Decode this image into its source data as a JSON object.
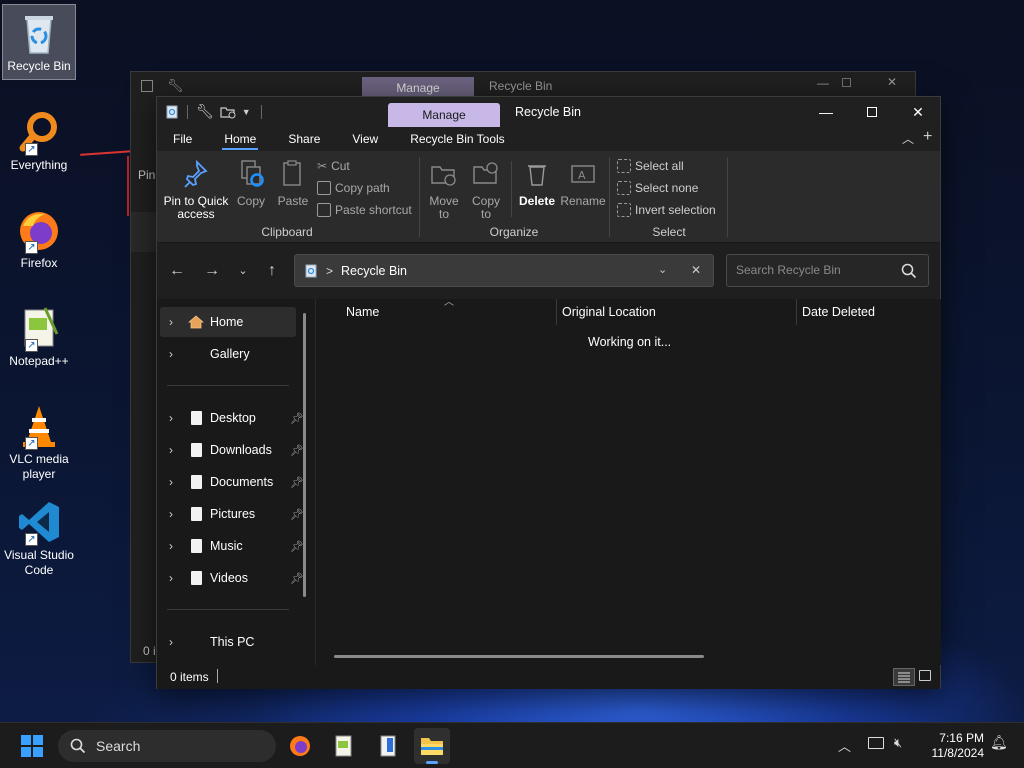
{
  "desktop": {
    "icons": [
      {
        "label": "Recycle Bin"
      },
      {
        "label": "Everything"
      },
      {
        "label": "Firefox"
      },
      {
        "label": "Notepad++"
      },
      {
        "label": "VLC media player"
      },
      {
        "label": "Visual Studio Code"
      }
    ]
  },
  "back_window": {
    "manage_label": "Manage",
    "title": "Recycle Bin",
    "peek_pin": "Pin",
    "peek_status": "0 i"
  },
  "window": {
    "manage_label": "Manage",
    "title": "Recycle Bin",
    "tabs": [
      "File",
      "Home",
      "Share",
      "View",
      "Recycle Bin Tools"
    ],
    "active_tab": "Home",
    "ribbon": {
      "clipboard": {
        "label": "Clipboard",
        "pin": "Pin to Quick access",
        "copy": "Copy",
        "paste": "Paste",
        "cut": "Cut",
        "copy_path": "Copy path",
        "paste_shortcut": "Paste shortcut"
      },
      "organize": {
        "label": "Organize",
        "move_to": "Move to",
        "copy_to": "Copy to",
        "delete": "Delete",
        "rename": "Rename"
      },
      "select": {
        "label": "Select",
        "select_all": "Select all",
        "select_none": "Select none",
        "invert": "Invert selection"
      }
    },
    "address": {
      "path": "Recycle Bin",
      "separator": ">"
    },
    "search": {
      "placeholder": "Search Recycle Bin"
    },
    "nav": {
      "home": "Home",
      "gallery": "Gallery",
      "pinned": [
        "Desktop",
        "Downloads",
        "Documents",
        "Pictures",
        "Music",
        "Videos"
      ],
      "this_pc": "This PC"
    },
    "columns": [
      "Name",
      "Original Location",
      "Date Deleted"
    ],
    "status_message": "Working on it...",
    "status_bar": "0 items"
  },
  "taskbar": {
    "search_label": "Search",
    "time": "7:16 PM",
    "date": "11/8/2024"
  },
  "colors": {
    "accent": "#5aa0ff",
    "manage_tab": "#c7b8e8"
  }
}
